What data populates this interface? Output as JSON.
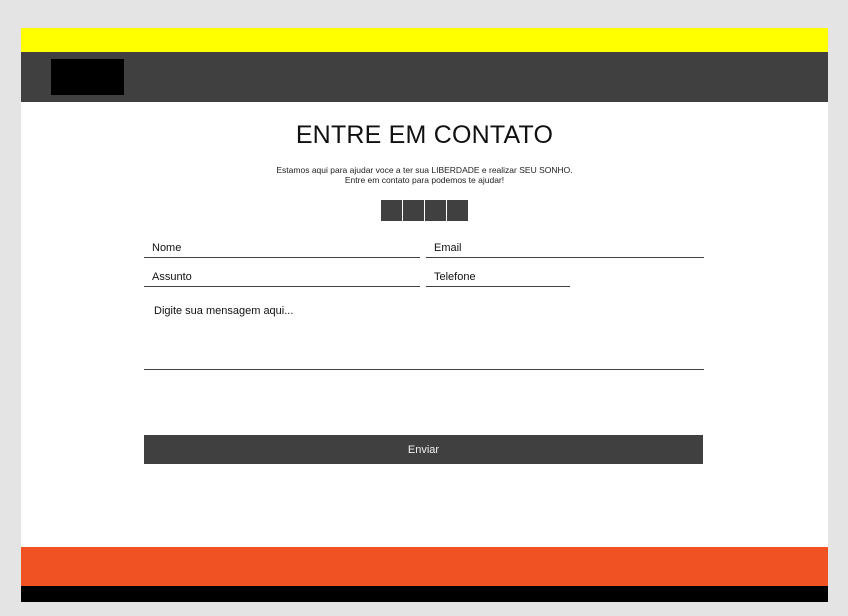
{
  "contact": {
    "title": "ENTRE EM CONTATO",
    "subtitle_line1": "Estamos aqui para ajudar voce a ter sua LIBERDADE e realizar SEU SONHO.",
    "subtitle_line2": "Entre em contato para podemos te ajudar!"
  },
  "social_icons": [
    "social-icon-1",
    "social-icon-2",
    "social-icon-3",
    "social-icon-4"
  ],
  "form": {
    "name_placeholder": "Nome",
    "email_placeholder": "Email",
    "subject_placeholder": "Assunto",
    "phone_placeholder": "Telefone",
    "message_placeholder": "Digite sua mensagem aqui...",
    "submit_label": "Enviar"
  },
  "colors": {
    "top_strip": "#ffff00",
    "header": "#404040",
    "footer_accent": "#f15223",
    "footer_bottom": "#000000"
  }
}
